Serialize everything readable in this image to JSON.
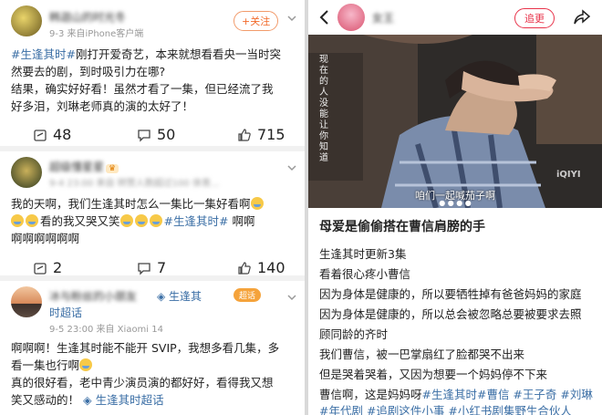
{
  "left": {
    "post1": {
      "user": "韩迦山的时光冬",
      "meta": "9-3 来自iPhone客户端",
      "follow": "+关注",
      "tag": "#生逢其时#",
      "text_after_tag": "刚打开爱奇艺，本来就想看看央一当时突",
      "line2": "然要去的剧，到时吸引力在哪?",
      "line3": "结果，确实好好看！虽然才看了一集，但已经流了我",
      "line4": "好多泪，刘琳老师真的演的太好了！",
      "reposts": "48",
      "comments": "50",
      "likes": "715"
    },
    "post2": {
      "user": "超级懂星星",
      "meta": "9-4 23:00 来自 转赞人数超过100 体育...",
      "line1": "我的天啊，我们生逢其时怎么一集比一集好看啊",
      "line2_a": "看的我又哭又笑",
      "line2_tag": "#生逢其时#",
      "line2_b": "啊啊",
      "line3": "啊啊啊啊啊啊",
      "reposts": "2",
      "comments": "7",
      "likes": "140"
    },
    "post3": {
      "user": "冰与粉丝的小朋友",
      "topic": "生逢其",
      "topic2": "时超话",
      "chaohua": "超话",
      "meta": "9-5 23:00 来自 Xiaomi 14",
      "line1": "啊啊啊！生逢其时能不能开 SVIP，我想多看几集，多",
      "line2": "看一集也行啊",
      "line3": "真的很好看，老中青少演员演的都好好，看得我又想",
      "line4_a": "笑又感动的！",
      "line4_topic": "生逢其时超话"
    }
  },
  "right": {
    "user": "女王",
    "follow": "追更",
    "photo_vertical_text": "现在的人没能让你知道",
    "subtitle": "咱们一起喊茄子啊",
    "watermark": "iQIYI",
    "title": "母爱是偷偷搭在曹信肩膀的手",
    "lines": [
      "生逢其时更新3集",
      "看着很心疼小曹信",
      "因为身体是健康的，所以要牺牲掉有爸爸妈妈的家庭",
      "因为身体是健康的，所以总会被忽略总要被要求去照",
      "顾同龄的齐时",
      "我们曹信，被一巴掌扇红了脸都哭不出来",
      "但是哭着哭着，又因为想要一个妈妈停不下来"
    ],
    "line8_a": "曹信啊，这是妈妈呀",
    "line8_tags": "#生逢其时#曹信 #王子奇 #刘琳",
    "line9_tags": "#年代剧 #追剧这件小事 #小红书剧集野生合伙人"
  }
}
